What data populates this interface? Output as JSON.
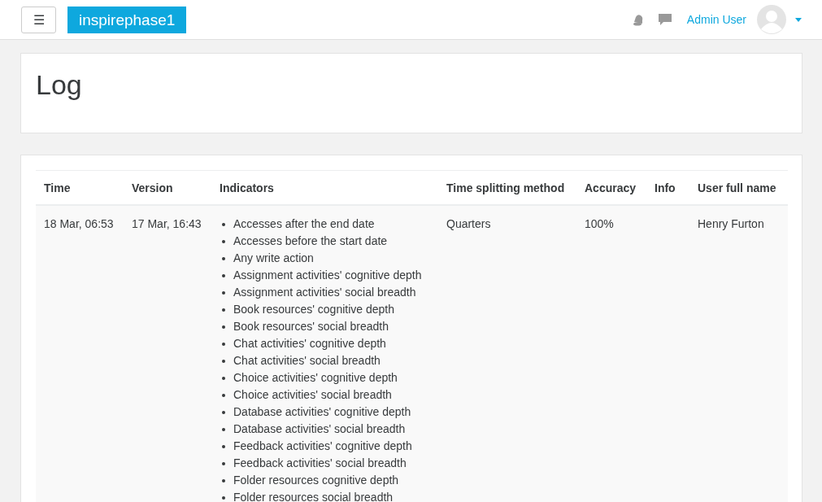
{
  "navbar": {
    "menu_button": "☰",
    "site_name": "inspirephase1",
    "user_name": "Admin User"
  },
  "page": {
    "title": "Log"
  },
  "table": {
    "columns": [
      "Time",
      "Version",
      "Indicators",
      "Time splitting method",
      "Accuracy",
      "Info",
      "User full name"
    ],
    "rows": [
      {
        "time": "18 Mar, 06:53",
        "version": "17 Mar, 16:43",
        "indicators": [
          "Accesses after the end date",
          "Accesses before the start date",
          "Any write action",
          "Assignment activities' cognitive depth",
          "Assignment activities' social breadth",
          "Book resources' cognitive depth",
          "Book resources' social breadth",
          "Chat activities' cognitive depth",
          "Chat activities' social breadth",
          "Choice activities' cognitive depth",
          "Choice activities' social breadth",
          "Database activities' cognitive depth",
          "Database activities' social breadth",
          "Feedback activities' cognitive depth",
          "Feedback activities' social breadth",
          "Folder resources cognitive depth",
          "Folder resources social breadth"
        ],
        "time_splitting_method": "Quarters",
        "accuracy": "100%",
        "info": "",
        "user_full_name": "Henry Furton"
      }
    ]
  }
}
